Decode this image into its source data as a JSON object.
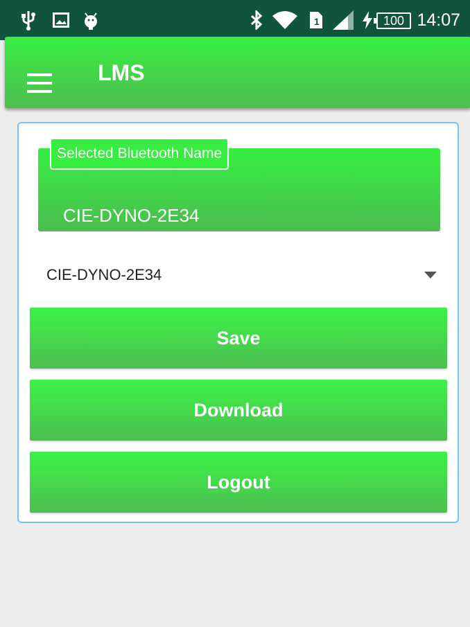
{
  "status_bar": {
    "icons": [
      "usb-icon",
      "image-icon",
      "android-icon",
      "bluetooth-icon",
      "wifi-icon",
      "sim-icon",
      "signal-icon",
      "charging-icon"
    ],
    "battery": "100",
    "time": "14:07"
  },
  "app_bar": {
    "title": "LMS",
    "menu_icon": "hamburger-menu-icon"
  },
  "bluetooth": {
    "label": "Selected Bluetooth Name",
    "value": "CIE-DYNO-2E34"
  },
  "dropdown": {
    "selected": "CIE-DYNO-2E34"
  },
  "buttons": {
    "save": "Save",
    "download": "Download",
    "logout": "Logout"
  },
  "colors": {
    "status_bar": "#11543d",
    "primary_green": "#39ee44",
    "card_border": "#76c5f0"
  }
}
